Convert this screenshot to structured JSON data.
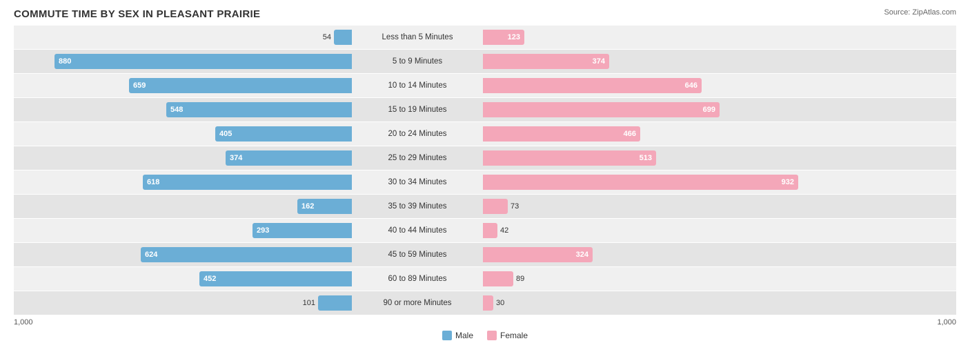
{
  "title": "COMMUTE TIME BY SEX IN PLEASANT PRAIRIE",
  "source": "Source: ZipAtlas.com",
  "scale_max": 1000,
  "scale_width": 490,
  "axis_labels": {
    "left": "1,000",
    "right": "1,000"
  },
  "legend": {
    "male_label": "Male",
    "female_label": "Female",
    "male_color": "#6baed6",
    "female_color": "#f4a7b9"
  },
  "rows": [
    {
      "label": "Less than 5 Minutes",
      "male": 54,
      "female": 123
    },
    {
      "label": "5 to 9 Minutes",
      "male": 880,
      "female": 374
    },
    {
      "label": "10 to 14 Minutes",
      "male": 659,
      "female": 646
    },
    {
      "label": "15 to 19 Minutes",
      "male": 548,
      "female": 699
    },
    {
      "label": "20 to 24 Minutes",
      "male": 405,
      "female": 466
    },
    {
      "label": "25 to 29 Minutes",
      "male": 374,
      "female": 513
    },
    {
      "label": "30 to 34 Minutes",
      "male": 618,
      "female": 932
    },
    {
      "label": "35 to 39 Minutes",
      "male": 162,
      "female": 73
    },
    {
      "label": "40 to 44 Minutes",
      "male": 293,
      "female": 42
    },
    {
      "label": "45 to 59 Minutes",
      "male": 624,
      "female": 324
    },
    {
      "label": "60 to 89 Minutes",
      "male": 452,
      "female": 89
    },
    {
      "label": "90 or more Minutes",
      "male": 101,
      "female": 30
    }
  ]
}
